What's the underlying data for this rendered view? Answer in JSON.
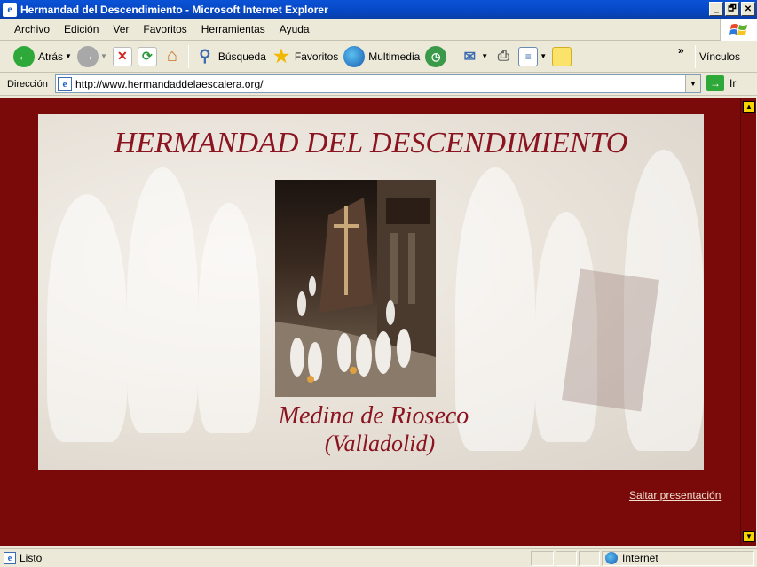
{
  "window": {
    "title": "Hermandad del Descendimiento - Microsoft Internet Explorer",
    "buttons": {
      "minimize": "_",
      "maximize": "🗗",
      "close": "✕"
    }
  },
  "menu": {
    "items": [
      "Archivo",
      "Edición",
      "Ver",
      "Favoritos",
      "Herramientas",
      "Ayuda"
    ]
  },
  "toolbar": {
    "back": "Atrás",
    "search": "Búsqueda",
    "favorites": "Favoritos",
    "multimedia": "Multimedia",
    "overflow": "»",
    "links": "Vínculos"
  },
  "address": {
    "label": "Dirección",
    "url": "http://www.hermandaddelaescalera.org/",
    "go": "Ir"
  },
  "page": {
    "heading": "HERMANDAD DEL DESCENDIMIENTO",
    "place": "Medina de Rioseco",
    "province": "(Valladolid)",
    "skip_link": "Saltar presentación",
    "background_color": "#7a0a0a",
    "accent_color": "#8a1420"
  },
  "status": {
    "text": "Listo",
    "zone": "Internet"
  }
}
